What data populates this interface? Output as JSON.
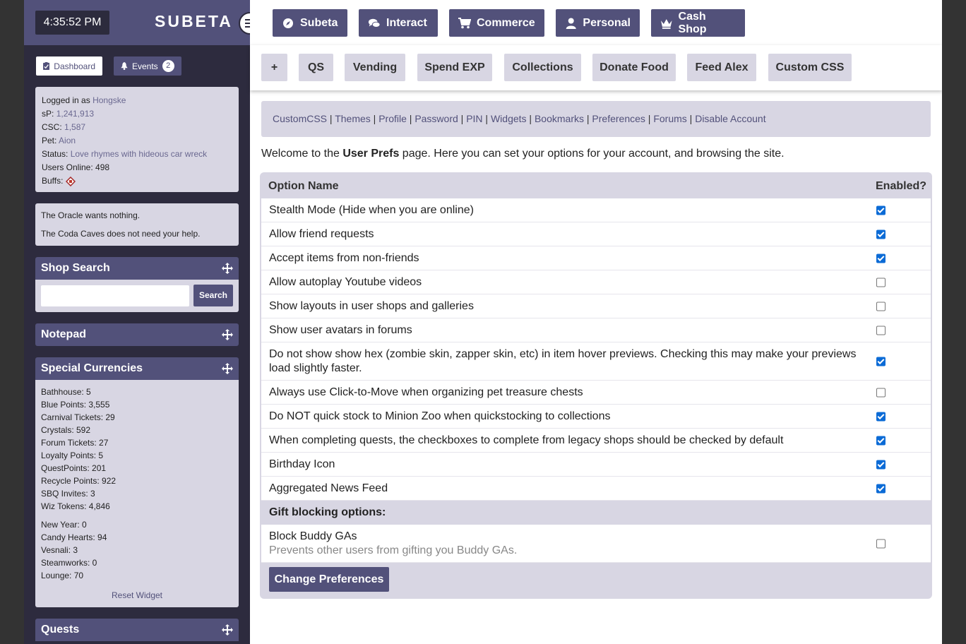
{
  "clock": "4:35:52 PM",
  "logo": "SUBETA",
  "sidebar_tabs": {
    "dashboard": "Dashboard",
    "events": "Events",
    "events_count": "2"
  },
  "user": {
    "logged_in_label": "Logged in as",
    "username": "Hongske",
    "sp_label": "sP:",
    "sp": "1,241,913",
    "csc_label": "CSC:",
    "csc": "1,587",
    "pet_label": "Pet:",
    "pet": "Aion",
    "status_label": "Status:",
    "status": "Love rhymes with hideous car wreck",
    "users_online": "Users Online: 498",
    "buffs_label": "Buffs:"
  },
  "oracle": {
    "line1": "The Oracle wants nothing.",
    "line2": "The Coda Caves does not need your help."
  },
  "widgets": {
    "shop_search": "Shop Search",
    "search_button": "Search",
    "notepad": "Notepad",
    "special_currencies": "Special Currencies",
    "quests": "Quests",
    "reset_widget": "Reset Widget"
  },
  "currencies": [
    "Bathhouse: 5",
    "Blue Points: 3,555",
    "Carnival Tickets: 29",
    "Crystals: 592",
    "Forum Tickets: 27",
    "Loyalty Points: 5",
    "QuestPoints: 201",
    "Recycle Points: 922",
    "SBQ Invites: 3",
    "Wiz Tokens: 4,846"
  ],
  "event_currencies": [
    "New Year: 0",
    "Candy Hearts: 94",
    "Vesnali: 3",
    "Steamworks: 0",
    "Lounge: 70"
  ],
  "nav": [
    "Subeta",
    "Interact",
    "Commerce",
    "Personal",
    "Cash Shop"
  ],
  "subnav": [
    "+",
    "QS",
    "Vending",
    "Spend EXP",
    "Collections",
    "Donate Food",
    "Feed Alex",
    "Custom CSS"
  ],
  "links": [
    "CustomCSS",
    "Themes",
    "Profile",
    "Password",
    "PIN",
    "Widgets",
    "Bookmarks",
    "Preferences",
    "Forums",
    "Disable Account"
  ],
  "welcome": {
    "pre": "Welcome to the ",
    "bold": "User Prefs",
    "post": " page. Here you can set your options for your account, and browsing the site."
  },
  "table": {
    "col_option": "Option Name",
    "col_enabled": "Enabled?",
    "options": [
      {
        "label": "Stealth Mode (Hide when you are online)",
        "enabled": true
      },
      {
        "label": "Allow friend requests",
        "enabled": true
      },
      {
        "label": "Accept items from non-friends",
        "enabled": true
      },
      {
        "label": "Allow autoplay Youtube videos",
        "enabled": false
      },
      {
        "label": "Show layouts in user shops and galleries",
        "enabled": false
      },
      {
        "label": "Show user avatars in forums",
        "enabled": false
      },
      {
        "label": "Do not show show hex (zombie skin, zapper skin, etc) in item hover previews. Checking this may make your previews load slightly faster.",
        "enabled": true
      },
      {
        "label": "Always use Click-to-Move when organizing pet treasure chests",
        "enabled": false
      },
      {
        "label": "Do NOT quick stock to Minion Zoo when quickstocking to collections",
        "enabled": true
      },
      {
        "label": "When completing quests, the checkboxes to complete from legacy shops should be checked by default",
        "enabled": true
      },
      {
        "label": "Birthday Icon",
        "enabled": true
      },
      {
        "label": "Aggregated News Feed",
        "enabled": true
      }
    ],
    "gift_section": "Gift blocking options:",
    "gift_option": {
      "label": "Block Buddy GAs",
      "desc": "Prevents other users from gifting you Buddy GAs.",
      "enabled": false
    }
  },
  "submit": "Change Preferences",
  "colors": {
    "primary": "#52517a",
    "sidebar": "#2d2b3e",
    "panel": "#d8d6e3",
    "checkbox": "#0b6bd6"
  }
}
